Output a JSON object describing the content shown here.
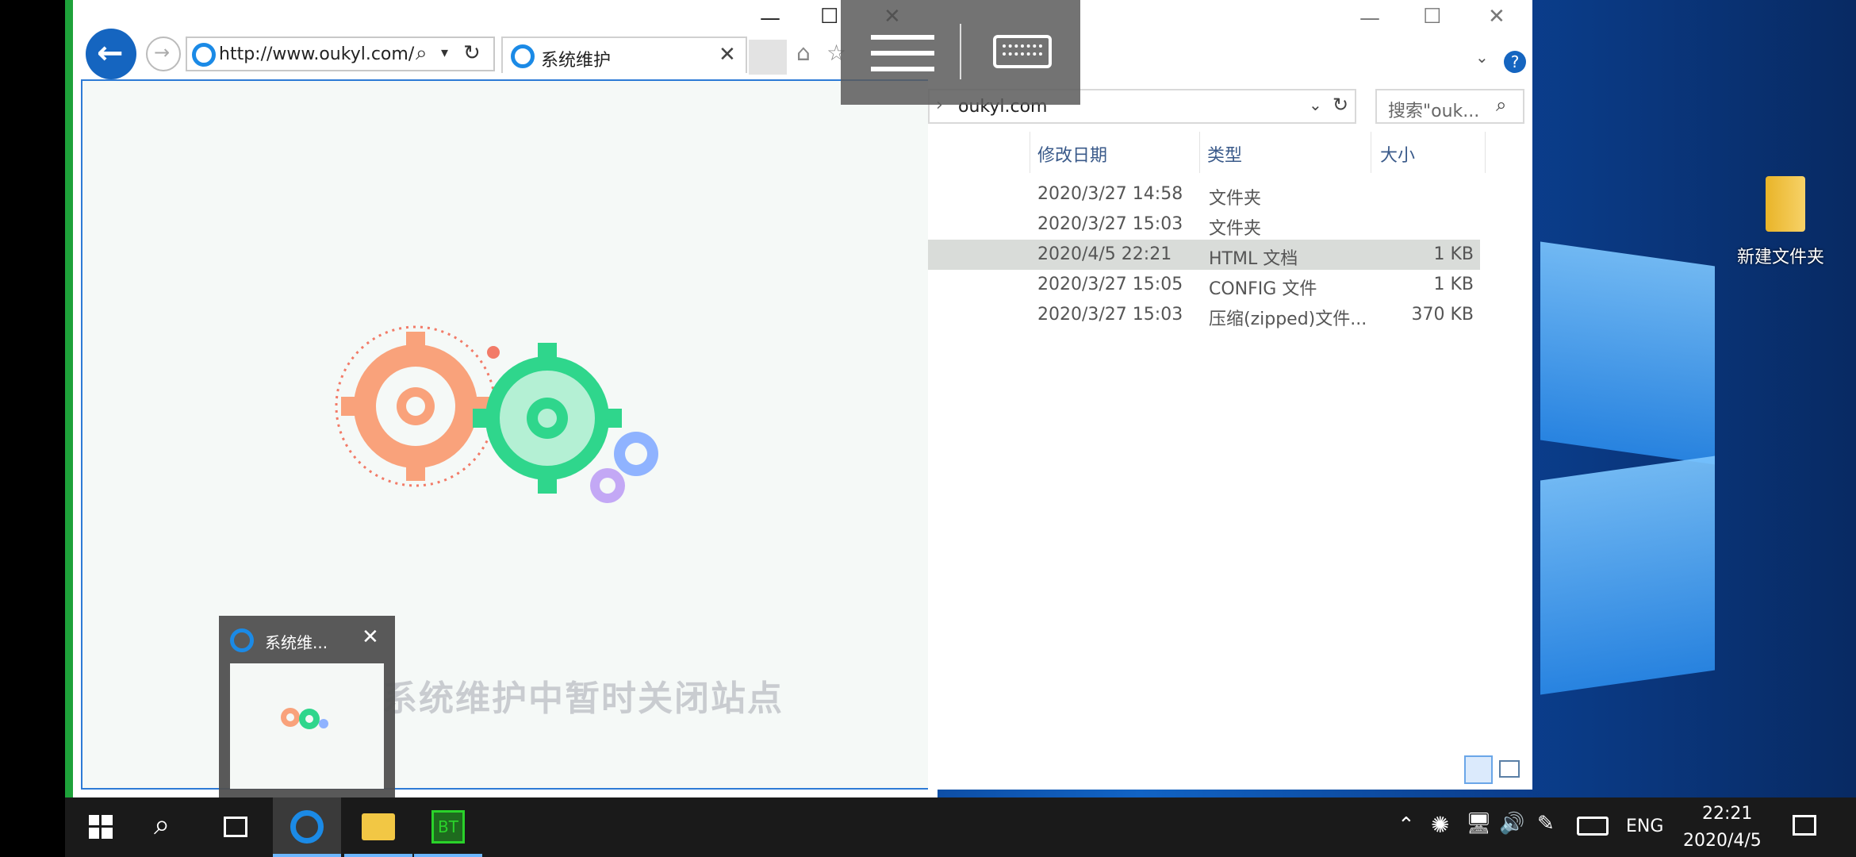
{
  "ie": {
    "address": "http://www.oukyl.com/",
    "tab_title": "系统维护",
    "tab_close": "✕",
    "page_heading": "系统维护中暂时关闭站点"
  },
  "overlay": {
    "menu_icon": "hamburger-icon",
    "keyboard_icon": "keyboard-icon"
  },
  "explorer": {
    "path": "oukyl.com",
    "path_arrow": "›",
    "search_placeholder": "搜索\"ouk...",
    "columns": [
      "修改日期",
      "类型",
      "大小"
    ],
    "rows": [
      {
        "date": "2020/3/27 14:58",
        "type": "文件夹",
        "size": ""
      },
      {
        "date": "2020/3/27 15:03",
        "type": "文件夹",
        "size": ""
      },
      {
        "date": "2020/4/5 22:21",
        "type": "HTML 文档",
        "size": "1 KB"
      },
      {
        "date": "2020/3/27 15:05",
        "type": "CONFIG 文件",
        "size": "1 KB"
      },
      {
        "date": "2020/3/27 15:03",
        "type": "压缩(zipped)文件...",
        "size": "370 KB"
      }
    ],
    "selected_row": 2
  },
  "desktop": {
    "folder_label": "新建文件夹"
  },
  "thumbnail": {
    "title": "系统维...",
    "close": "✕"
  },
  "taskbar": {
    "apps": [
      "start",
      "search",
      "task-view",
      "internet-explorer",
      "file-explorer",
      "bt"
    ],
    "bt_label": "BT",
    "lang": "ENG",
    "time": "22:21",
    "date": "2020/4/5"
  },
  "colors": {
    "accent": "#1565c0",
    "selected_row": "#d9dcd9",
    "gear_orange": "#f9a27b",
    "gear_green": "#2fd68c",
    "gear_blue": "#8fb3ff",
    "gear_purple": "#c3a8f5"
  }
}
